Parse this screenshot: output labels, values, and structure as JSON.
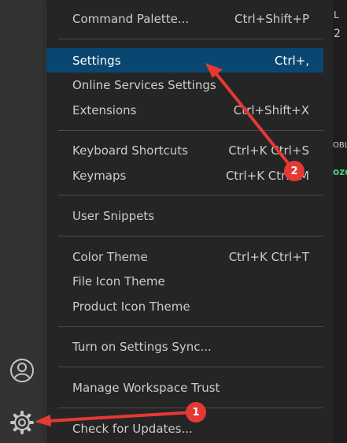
{
  "activity_bar": {
    "account_icon": "account-icon",
    "settings_icon": "gear-icon"
  },
  "menu": {
    "items": [
      {
        "label": "Command Palette...",
        "shortcut": "Ctrl+Shift+P"
      },
      {
        "label": "Settings",
        "shortcut": "Ctrl+,",
        "highlighted": true
      },
      {
        "label": "Online Services Settings",
        "shortcut": ""
      },
      {
        "label": "Extensions",
        "shortcut": "Ctrl+Shift+X"
      },
      {
        "label": "Keyboard Shortcuts",
        "shortcut": "Ctrl+K Ctrl+S"
      },
      {
        "label": "Keymaps",
        "shortcut": "Ctrl+K Ctrl+M"
      },
      {
        "label": "User Snippets",
        "shortcut": ""
      },
      {
        "label": "Color Theme",
        "shortcut": "Ctrl+K Ctrl+T"
      },
      {
        "label": "File Icon Theme",
        "shortcut": ""
      },
      {
        "label": "Product Icon Theme",
        "shortcut": ""
      },
      {
        "label": "Turn on Settings Sync...",
        "shortcut": ""
      },
      {
        "label": "Manage Workspace Trust",
        "shortcut": ""
      },
      {
        "label": "Check for Updates...",
        "shortcut": ""
      }
    ]
  },
  "editor_edge": {
    "text_1": "L",
    "text_2": "2",
    "text_3": "OBL",
    "text_4": "ozo"
  },
  "annotations": {
    "badge_1": "1",
    "badge_2": "2",
    "color": "#e53935"
  },
  "colors": {
    "highlight": "#094771",
    "menu_bg": "#252526",
    "activity_bg": "#333333"
  }
}
